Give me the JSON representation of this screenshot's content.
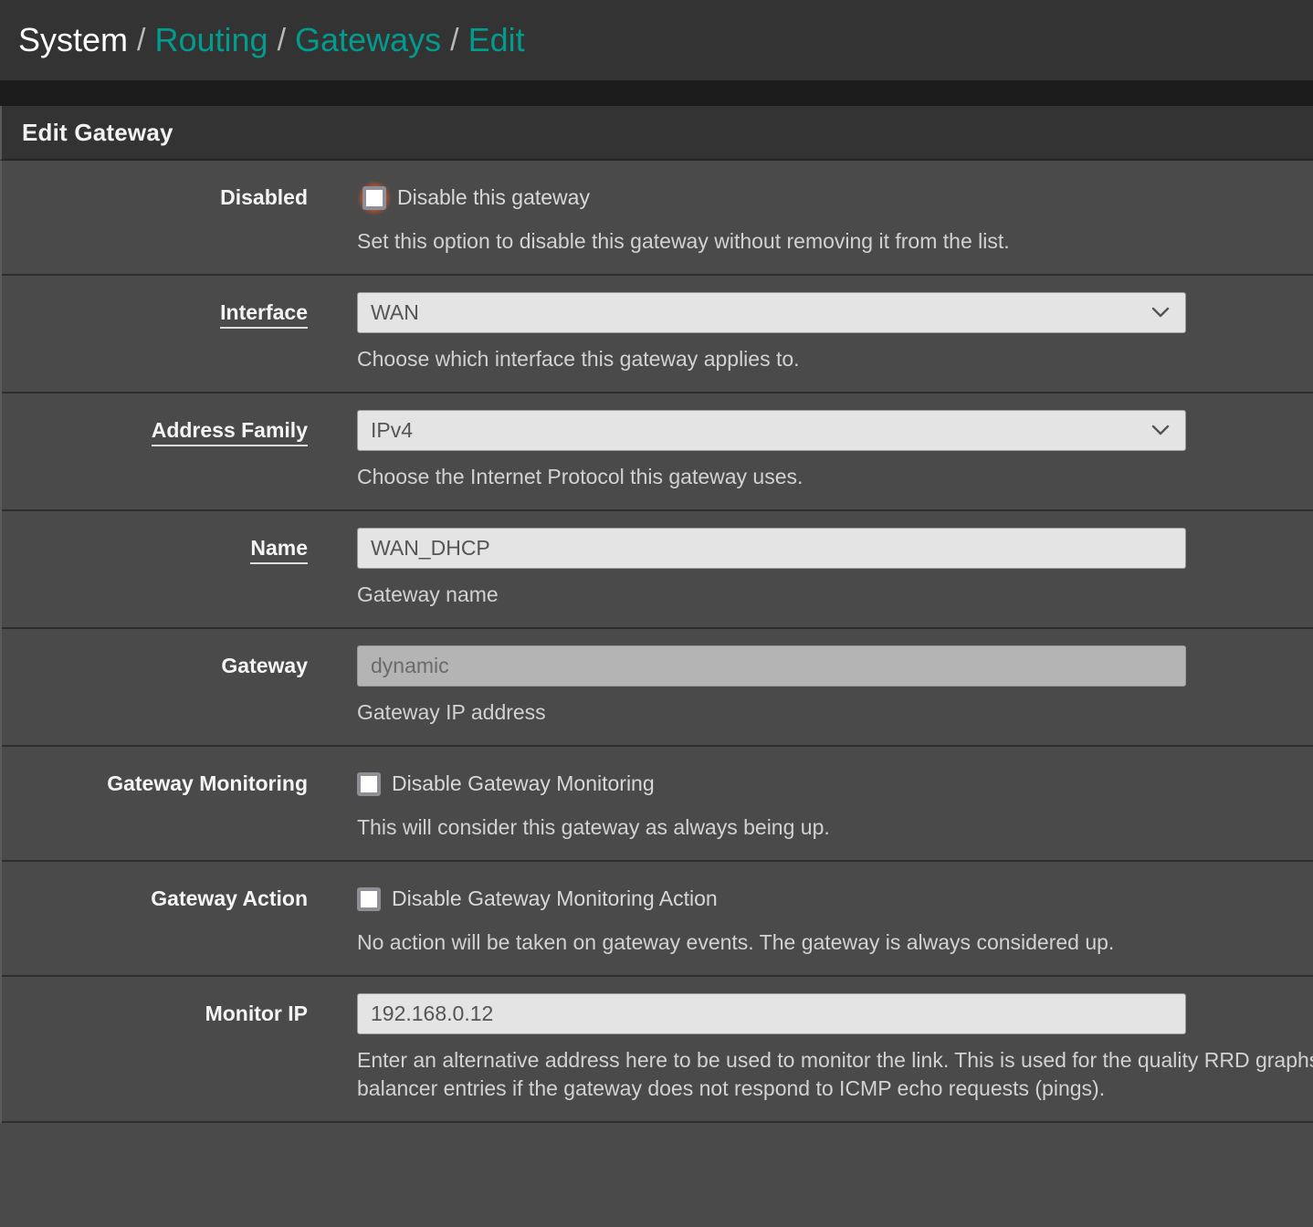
{
  "breadcrumb": {
    "separator": "/",
    "items": [
      {
        "label": "System",
        "link": false
      },
      {
        "label": "Routing",
        "link": true
      },
      {
        "label": "Gateways",
        "link": true
      },
      {
        "label": "Edit",
        "link": true
      }
    ]
  },
  "panel": {
    "heading": "Edit Gateway"
  },
  "colors": {
    "breadcrumb_link": "#019c8d",
    "focus_ring": "#e8551f",
    "panel_background": "#333333",
    "form_background": "#4a4a4a"
  },
  "form": {
    "disabled": {
      "label": "Disabled",
      "checkbox_label": "Disable this gateway",
      "checked": false,
      "focused": true,
      "help": "Set this option to disable this gateway without removing it from the list."
    },
    "interface": {
      "label": "Interface",
      "label_underlined": true,
      "value": "WAN",
      "help": "Choose which interface this gateway applies to."
    },
    "address_family": {
      "label": "Address Family",
      "label_underlined": true,
      "value": "IPv4",
      "help": "Choose the Internet Protocol this gateway uses."
    },
    "name": {
      "label": "Name",
      "label_underlined": true,
      "value": "WAN_DHCP",
      "help": "Gateway name"
    },
    "gateway": {
      "label": "Gateway",
      "value": "dynamic",
      "disabled": true,
      "help": "Gateway IP address"
    },
    "gateway_monitoring": {
      "label": "Gateway Monitoring",
      "checkbox_label": "Disable Gateway Monitoring",
      "checked": false,
      "help": "This will consider this gateway as always being up."
    },
    "gateway_action": {
      "label": "Gateway Action",
      "checkbox_label": "Disable Gateway Monitoring Action",
      "checked": false,
      "help": "No action will be taken on gateway events. The gateway is always considered up."
    },
    "monitor_ip": {
      "label": "Monitor IP",
      "value": "192.168.0.12",
      "help": "Enter an alternative address here to be used to monitor the link. This is used for the quality RRD graphs as well as the load balancer entries if the gateway does not respond to ICMP echo requests (pings)."
    }
  }
}
